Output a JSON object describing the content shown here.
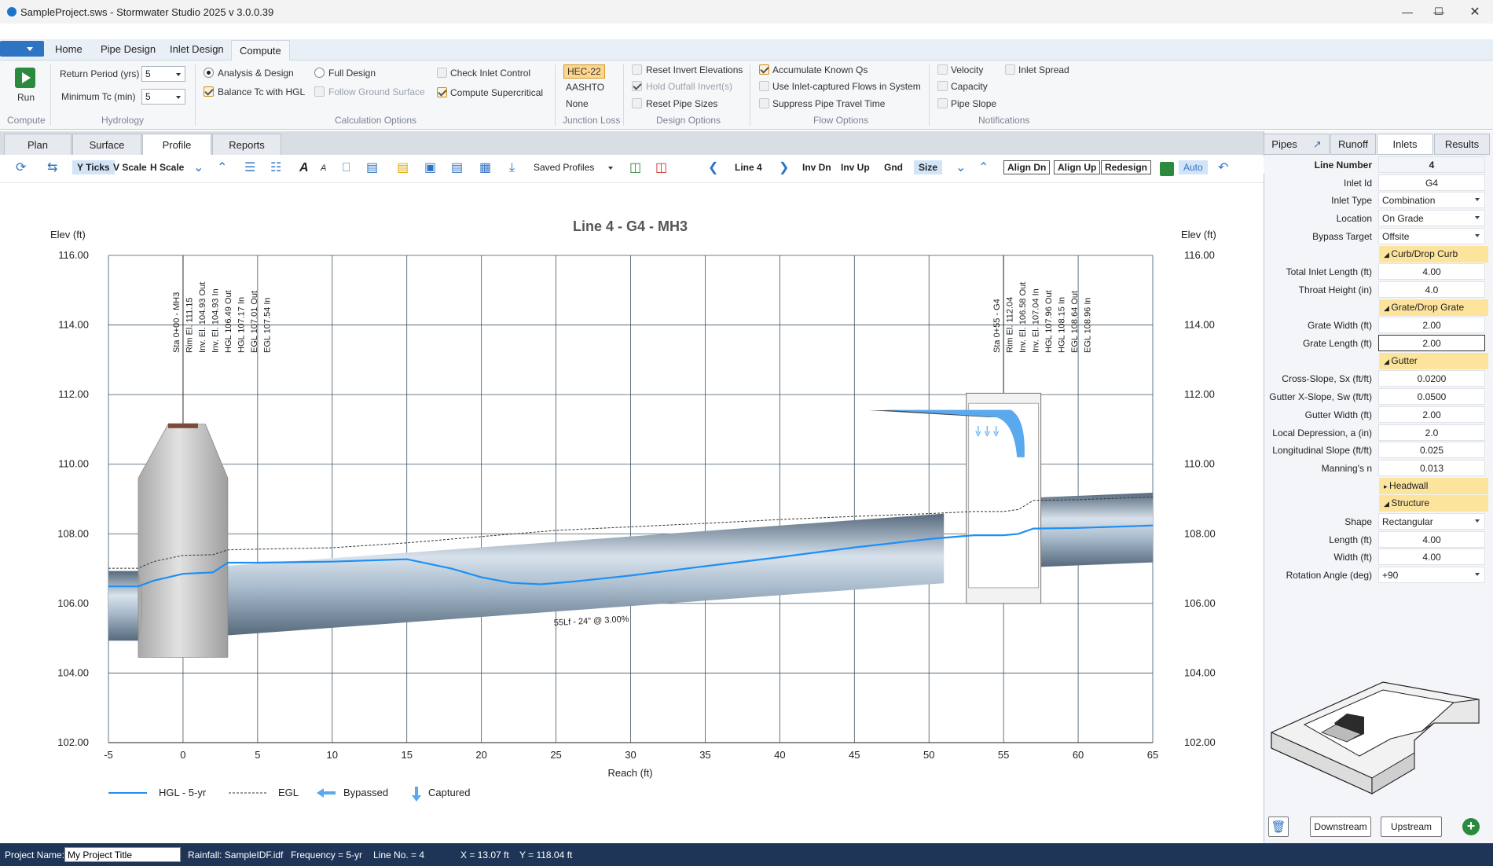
{
  "window": {
    "title": "SampleProject.sws - Stormwater Studio 2025 v 3.0.0.39"
  },
  "menu": {
    "tabs": [
      "Home",
      "Pipe Design",
      "Inlet Design",
      "Compute"
    ],
    "active": "Compute"
  },
  "ribbon": {
    "run_label": "Run",
    "groups": {
      "compute": "Compute",
      "hydrology": "Hydrology",
      "calc_options": "Calculation Options",
      "junction_loss": "Junction Loss",
      "design_options": "Design Options",
      "flow_options": "Flow Options",
      "notifications": "Notifications"
    },
    "return_period_label": "Return Period (yrs)",
    "return_period_value": "5",
    "min_tc_label": "Minimum Tc (min)",
    "min_tc_value": "5",
    "analysis_design": "Analysis & Design",
    "full_design": "Full Design",
    "balance_tc": "Balance Tc with HGL",
    "follow_ground": "Follow Ground Surface",
    "check_inlet": "Check Inlet Control",
    "compute_supercritical": "Compute Supercritical",
    "junction_methods": [
      "HEC-22",
      "AASHTO",
      "None"
    ],
    "reset_invert": "Reset Invert Elevations",
    "hold_outfall": "Hold Outfall Invert(s)",
    "reset_pipe": "Reset Pipe Sizes",
    "accumulate_qs": "Accumulate Known Qs",
    "use_inlet_captured": "Use Inlet-captured Flows in System",
    "suppress_travel": "Suppress Pipe Travel Time",
    "velocity": "Velocity",
    "capacity": "Capacity",
    "pipe_slope": "Pipe Slope",
    "inlet_spread": "Inlet Spread"
  },
  "view_tabs": [
    "Plan",
    "Surface",
    "Profile",
    "Reports"
  ],
  "toolbar": {
    "y_ticks": "Y Ticks",
    "v_scale": "V Scale",
    "h_scale": "H Scale",
    "saved_profiles": "Saved Profiles",
    "line": "Line 4",
    "inv_dn": "Inv Dn",
    "inv_up": "Inv Up",
    "gnd": "Gnd",
    "size": "Size",
    "align_dn": "Align Dn",
    "align_up": "Align Up",
    "redesign": "Redesign",
    "auto": "Auto"
  },
  "chart_data": {
    "type": "line",
    "title": "Line 4 - G4 - MH3",
    "xlabel": "Reach (ft)",
    "ylabel": "Elev (ft)",
    "ylabel_right": "Elev (ft)",
    "xlim": [
      -5,
      65
    ],
    "ylim": [
      102,
      116
    ],
    "x_ticks": [
      "-5",
      "0",
      "5",
      "10",
      "15",
      "20",
      "25",
      "30",
      "35",
      "40",
      "45",
      "50",
      "55",
      "60",
      "65"
    ],
    "y_ticks": [
      "102.00",
      "104.00",
      "106.00",
      "108.00",
      "110.00",
      "112.00",
      "114.00",
      "116.00"
    ],
    "grid": true,
    "legend_position": "bottom-left",
    "legend": [
      "HGL - 5-yr",
      "EGL",
      "Bypassed",
      "Captured"
    ],
    "pipe_label": "55Lf - 24\" @ 3.00%",
    "series": [
      {
        "name": "HGL - 5-yr",
        "color": "#1e8ff5",
        "x": [
          -5,
          -3,
          -2,
          0,
          2,
          3,
          5,
          10,
          15,
          18,
          20,
          22,
          24,
          26,
          30,
          35,
          40,
          45,
          50,
          53,
          55,
          56,
          57,
          60,
          65
        ],
        "y": [
          106.49,
          106.49,
          106.65,
          106.85,
          106.89,
          107.17,
          107.17,
          107.2,
          107.27,
          107.0,
          106.75,
          106.59,
          106.55,
          106.62,
          106.8,
          107.07,
          107.33,
          107.61,
          107.85,
          107.96,
          107.96,
          108.0,
          108.15,
          108.17,
          108.24
        ]
      },
      {
        "name": "EGL",
        "color": "#333333",
        "x": [
          -5,
          -3,
          -2,
          0,
          2,
          3,
          5,
          10,
          15,
          20,
          25,
          30,
          35,
          40,
          45,
          50,
          53,
          55,
          56,
          57,
          60,
          65
        ],
        "y": [
          107.01,
          107.01,
          107.2,
          107.38,
          107.4,
          107.54,
          107.56,
          107.6,
          107.74,
          107.92,
          108.1,
          108.2,
          108.3,
          108.41,
          108.5,
          108.58,
          108.64,
          108.64,
          108.7,
          108.96,
          108.98,
          109.06
        ]
      }
    ],
    "annotations_left": [
      "Sta 0+00 - MH3",
      "Rim El. 111.15",
      "Inv. El. 104.93 Out",
      "Inv. El. 104.93 In",
      "HGL 106.49 Out",
      "HGL 107.17 In",
      "EGL 107.01 Out",
      "EGL 107.54 In"
    ],
    "annotations_right": [
      "Sta 0+55 - G4",
      "Rim El. 112.04",
      "Inv. El. 106.58 Out",
      "Inv. El. 107.04 In",
      "HGL 107.96 Out",
      "HGL 108.15 In",
      "EGL 108.64 Out",
      "EGL 108.96 In"
    ]
  },
  "side_tabs": [
    "Pipes",
    "Runoff",
    "Inlets",
    "Results"
  ],
  "inlet": {
    "line_number_label": "Line Number",
    "line_number": "4",
    "inlet_id_label": "Inlet Id",
    "inlet_id": "G4",
    "inlet_type_label": "Inlet Type",
    "inlet_type": "Combination",
    "location_label": "Location",
    "location": "On Grade",
    "bypass_label": "Bypass Target",
    "bypass": "Offsite",
    "sec_curb": "Curb/Drop Curb",
    "total_length_label": "Total Inlet Length (ft)",
    "total_length": "4.00",
    "throat_label": "Throat Height (in)",
    "throat": "4.0",
    "sec_grate": "Grate/Drop Grate",
    "grate_width_label": "Grate Width (ft)",
    "grate_width": "2.00",
    "grate_length_label": "Grate Length (ft)",
    "grate_length": "2.00",
    "sec_gutter": "Gutter",
    "sx_label": "Cross-Slope, Sx (ft/ft)",
    "sx": "0.0200",
    "sw_label": "Gutter X-Slope, Sw (ft/ft)",
    "sw": "0.0500",
    "gutter_width_label": "Gutter Width (ft)",
    "gutter_width": "2.00",
    "depression_label": "Local Depression, a (in)",
    "depression": "2.0",
    "long_slope_label": "Longitudinal Slope (ft/ft)",
    "long_slope": "0.025",
    "mannings_label": "Manning's n",
    "mannings": "0.013",
    "sec_headwall": "Headwall",
    "sec_structure": "Structure",
    "shape_label": "Shape",
    "shape": "Rectangular",
    "length_label": "Length (ft)",
    "length": "4.00",
    "width_label": "Width (ft)",
    "width": "4.00",
    "rotation_label": "Rotation Angle (deg)",
    "rotation": "+90",
    "downstream": "Downstream",
    "upstream": "Upstream"
  },
  "status": {
    "project_label": "Project Name:",
    "project_name": "My Project Title",
    "rainfall": "Rainfall: SampleIDF.idf",
    "frequency": "Frequency = 5-yr",
    "line_no": "Line No. = 4",
    "x": "X = 13.07 ft",
    "y": "Y = 118.04 ft"
  }
}
